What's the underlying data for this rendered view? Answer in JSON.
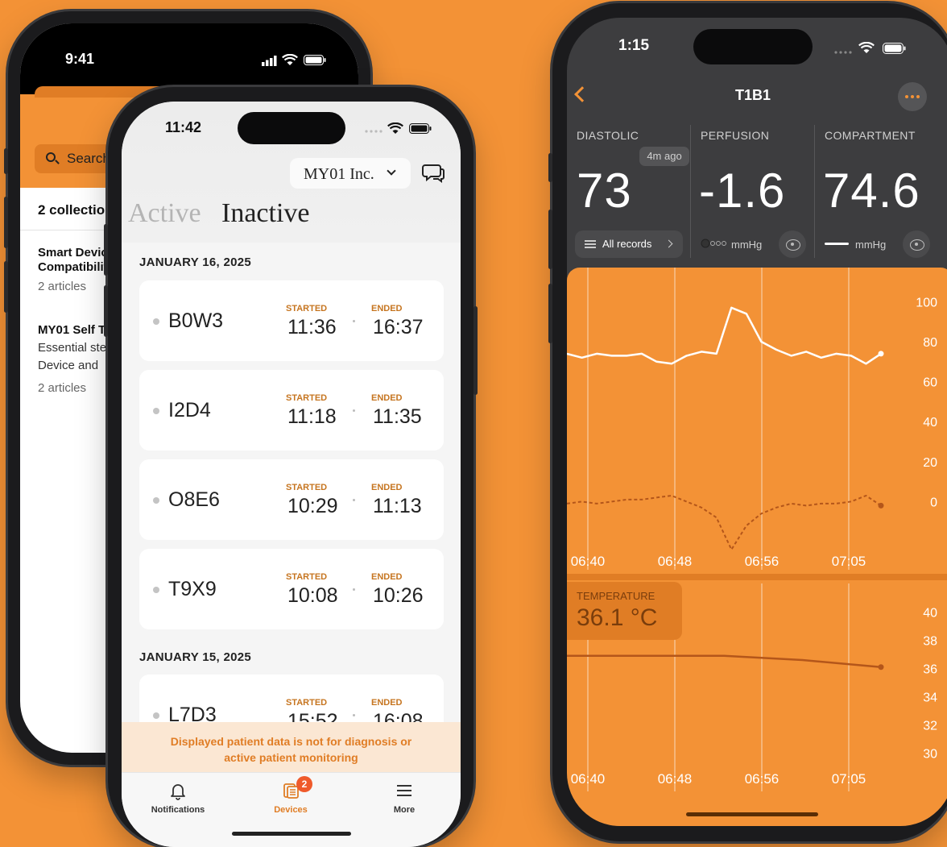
{
  "back_phone": {
    "status_time": "9:41",
    "search_placeholder": "Search",
    "collections_count": "2 collections",
    "items": [
      {
        "title_line1": "Smart Device",
        "title_line2": "Compatibility",
        "meta": "2 articles"
      },
      {
        "title_line1": "MY01 Self Test",
        "sub_line1": "Essential steps",
        "sub_line2": "Device and",
        "meta": "2 articles"
      }
    ]
  },
  "front_phone": {
    "status_time": "11:42",
    "org_name": "MY01 Inc.",
    "tabs": {
      "active": "Active",
      "inactive": "Inactive"
    },
    "started_label": "STARTED",
    "ended_label": "ENDED",
    "groups": [
      {
        "date": "JANUARY 16, 2025",
        "sessions": [
          {
            "code": "B0W3",
            "started": "11:36",
            "ended": "16:37"
          },
          {
            "code": "I2D4",
            "started": "11:18",
            "ended": "11:35"
          },
          {
            "code": "O8E6",
            "started": "10:29",
            "ended": "11:13"
          },
          {
            "code": "T9X9",
            "started": "10:08",
            "ended": "10:26"
          }
        ]
      },
      {
        "date": "JANUARY 15, 2025",
        "sessions": [
          {
            "code": "L7D3",
            "started": "15:52",
            "ended": "16:08"
          }
        ]
      }
    ],
    "disclaimer_line1": "Displayed patient data is not for diagnosis or",
    "disclaimer_line2": "active patient monitoring",
    "tabbar": [
      {
        "label": "Notifications",
        "icon": "bell-icon"
      },
      {
        "label": "Devices",
        "icon": "devices-icon",
        "badge": "2"
      },
      {
        "label": "More",
        "icon": "menu-icon"
      }
    ],
    "colors": {
      "accent": "#F39236",
      "badge": "#EF5A2B"
    }
  },
  "right_phone": {
    "status_time": "1:15",
    "title": "T1B1",
    "metrics": [
      {
        "label": "DIASTOLIC",
        "value": "73",
        "ago": "4m ago",
        "action": "All records"
      },
      {
        "label": "PERFUSION",
        "value": "-1.6",
        "unit": "mmHg"
      },
      {
        "label": "COMPARTMENT",
        "value": "74.6",
        "unit": "mmHg"
      }
    ],
    "temperature": {
      "label": "TEMPERATURE",
      "value": "36.1 °C"
    },
    "colors": {
      "background": "#3d3d3f",
      "chart": "#F39236"
    }
  },
  "chart_data": [
    {
      "type": "line",
      "x_ticks": [
        "06:40",
        "06:48",
        "06:56",
        "07:05"
      ],
      "y_ticks": [
        100,
        80,
        60,
        40,
        20,
        0
      ],
      "ylim": [
        -20,
        105
      ],
      "x": [
        0,
        1,
        2,
        3,
        4,
        5,
        6,
        7,
        8,
        9,
        10,
        11,
        12,
        13,
        14,
        15,
        16,
        17,
        18,
        19,
        20,
        21
      ],
      "series": [
        {
          "style": "solid",
          "values": [
            74,
            72,
            74,
            73,
            73,
            74,
            70,
            69,
            73,
            75,
            74,
            97,
            94,
            80,
            76,
            73,
            75,
            72,
            74,
            73,
            69,
            74
          ]
        },
        {
          "style": "dashed",
          "values": [
            -1,
            0,
            -1,
            0,
            1,
            1,
            2,
            3,
            0,
            -3,
            -8,
            -24,
            -12,
            -6,
            -3,
            -1,
            -2,
            -1,
            -1,
            0,
            3,
            -2
          ]
        }
      ]
    },
    {
      "type": "line",
      "x_ticks": [
        "06:40",
        "06:48",
        "06:56",
        "07:05"
      ],
      "y_ticks": [
        40,
        38,
        36,
        34,
        32,
        30
      ],
      "ylim": [
        29,
        41
      ],
      "x": [
        0,
        1,
        2,
        3,
        4
      ],
      "series": [
        {
          "style": "solid",
          "values": [
            36.9,
            36.9,
            36.9,
            36.6,
            36.1
          ]
        }
      ]
    }
  ]
}
